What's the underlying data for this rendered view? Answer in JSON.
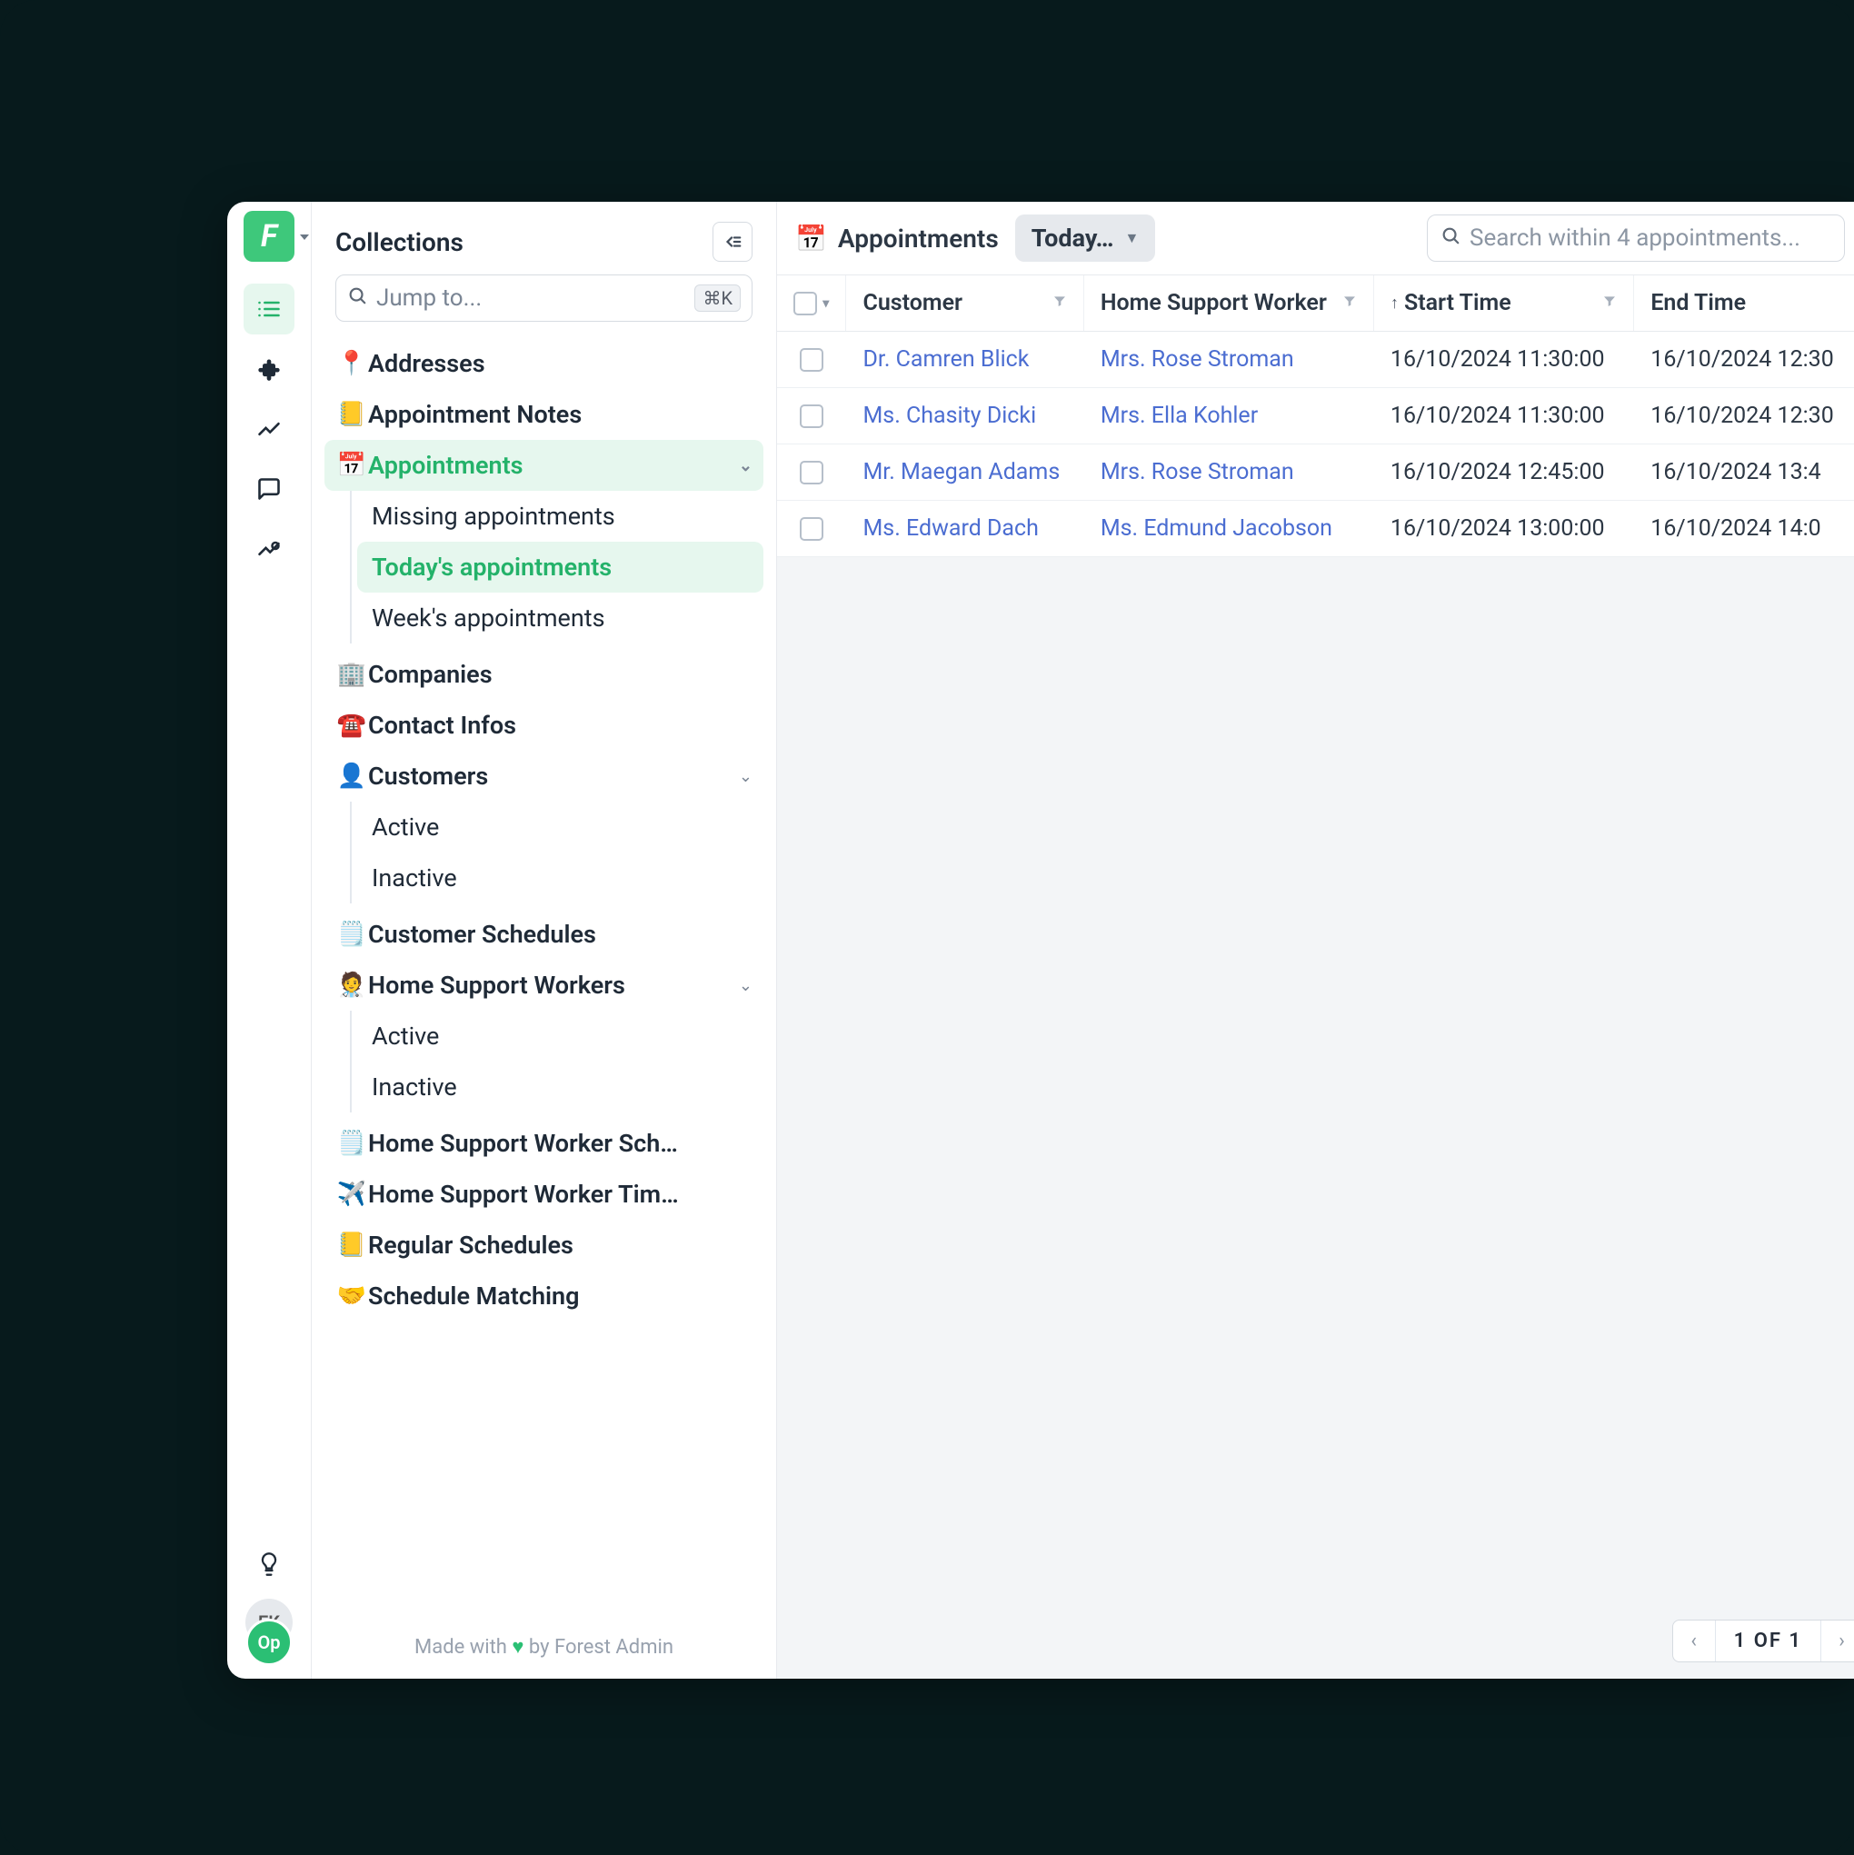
{
  "rail": {
    "logo_letter": "F",
    "items": [
      "list-icon",
      "puzzle-icon",
      "chart-line-icon",
      "chat-icon",
      "analytics-icon"
    ],
    "tip_icon": "lightbulb-icon",
    "avatars": {
      "top": "EK",
      "bottom": "Op"
    }
  },
  "sidebar": {
    "title": "Collections",
    "jump_placeholder": "Jump to...",
    "jump_shortcut": "⌘K",
    "nodes": [
      {
        "icon": "📍",
        "label": "Addresses",
        "bold": true
      },
      {
        "icon": "📒",
        "label": "Appointment Notes",
        "bold": true
      },
      {
        "icon": "📅",
        "label": "Appointments",
        "bold": true,
        "active": true,
        "expandable": true,
        "children": [
          {
            "label": "Missing appointments"
          },
          {
            "label": "Today's appointments",
            "active": true
          },
          {
            "label": "Week's appointments"
          }
        ]
      },
      {
        "icon": "🏢",
        "label": "Companies",
        "bold": true
      },
      {
        "icon": "☎️",
        "label": "Contact Infos",
        "bold": true
      },
      {
        "icon": "👤",
        "label": "Customers",
        "bold": true,
        "expandable": true,
        "children": [
          {
            "label": "Active"
          },
          {
            "label": "Inactive"
          }
        ]
      },
      {
        "icon": "🗒️",
        "label": "Customer Schedules",
        "bold": true
      },
      {
        "icon": "🧑‍⚕️",
        "label": "Home Support Workers",
        "bold": true,
        "expandable": true,
        "children": [
          {
            "label": "Active"
          },
          {
            "label": "Inactive"
          }
        ]
      },
      {
        "icon": "🗒️",
        "label": "Home Support Worker Sch…",
        "bold": true
      },
      {
        "icon": "✈️",
        "label": "Home Support Worker Tim…",
        "bold": true
      },
      {
        "icon": "📒",
        "label": "Regular Schedules",
        "bold": true
      },
      {
        "icon": "🤝",
        "label": "Schedule Matching",
        "bold": true
      }
    ],
    "footer_prefix": "Made with",
    "footer_suffix": "by Forest Admin"
  },
  "header": {
    "crumb_icon": "📅",
    "crumb_label": "Appointments",
    "segment_label": "Today…",
    "search_placeholder": "Search within 4 appointments..."
  },
  "table": {
    "columns": [
      {
        "key": "customer",
        "label": "Customer",
        "filter": true
      },
      {
        "key": "hsw",
        "label": "Home Support Worker",
        "filter": true
      },
      {
        "key": "start",
        "label": "Start Time",
        "filter": true,
        "sort": "asc"
      },
      {
        "key": "end",
        "label": "End Time"
      }
    ],
    "rows": [
      {
        "customer": "Dr. Camren Blick",
        "hsw": "Mrs. Rose Stroman",
        "start": "16/10/2024 11:30:00",
        "end": "16/10/2024 12:30"
      },
      {
        "customer": "Ms. Chasity Dicki",
        "hsw": "Mrs. Ella Kohler",
        "start": "16/10/2024 11:30:00",
        "end": "16/10/2024 12:30"
      },
      {
        "customer": "Mr. Maegan Adams",
        "hsw": "Mrs. Rose Stroman",
        "start": "16/10/2024 12:45:00",
        "end": "16/10/2024 13:4"
      },
      {
        "customer": "Ms. Edward Dach",
        "hsw": "Ms. Edmund Jacobson",
        "start": "16/10/2024 13:00:00",
        "end": "16/10/2024 14:0"
      }
    ]
  },
  "pager": {
    "label": "1 OF 1"
  }
}
